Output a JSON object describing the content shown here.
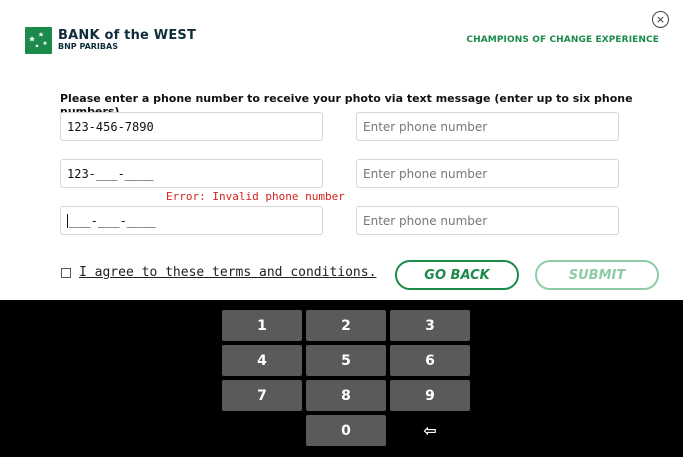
{
  "header": {
    "brand_line1": "BANK of the WEST",
    "brand_line2": "BNP PARIBAS",
    "tagline": "CHAMPIONS OF CHANGE EXPERIENCE",
    "close_glyph": "×"
  },
  "form": {
    "instruction": "Please enter a phone number to receive your photo via text message (enter up to six phone numbers).",
    "fields": [
      {
        "value": "123-456-7890"
      },
      {
        "placeholder": "Enter phone number"
      },
      {
        "value": "123-___-____"
      },
      {
        "placeholder": "Enter phone number"
      },
      {
        "value": "___-___-____"
      },
      {
        "placeholder": "Enter phone number"
      }
    ],
    "error": "Error: Invalid phone number",
    "agree_label": "I agree to these terms and conditions.",
    "back_label": "GO BACK",
    "submit_label": "SUBMIT"
  },
  "keypad": {
    "keys": [
      "1",
      "2",
      "3",
      "4",
      "5",
      "6",
      "7",
      "8",
      "9",
      "0",
      "⇦"
    ]
  },
  "colors": {
    "brand_green": "#1b8a4b",
    "disabled_green": "#8ccca6",
    "error_red": "#d0231f",
    "key_gray": "#5a5a5a"
  }
}
